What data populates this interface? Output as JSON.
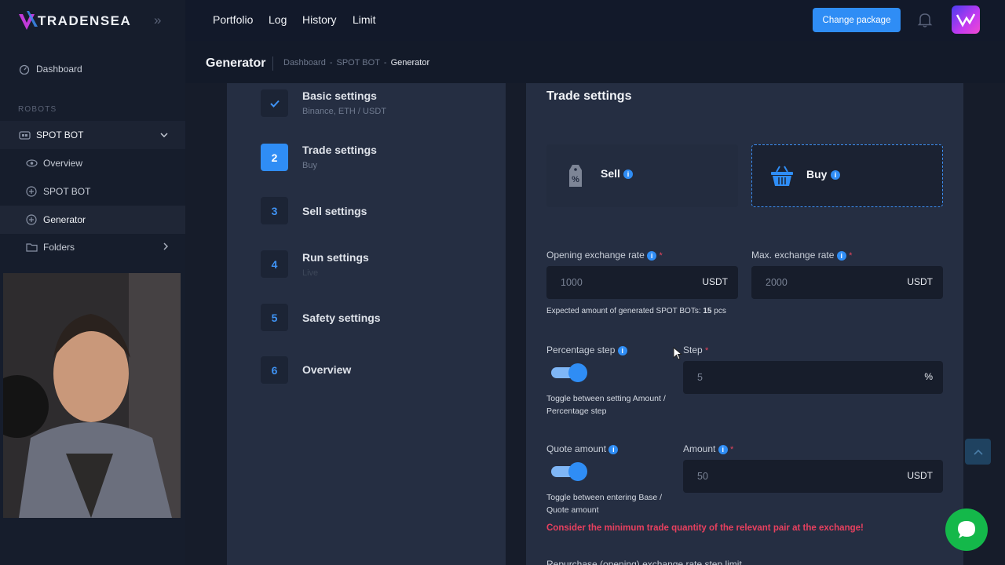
{
  "brand": {
    "name": "TRADENSEA"
  },
  "topnav": {
    "items": [
      "Portfolio",
      "Log",
      "History",
      "Limit"
    ],
    "change_package": "Change package"
  },
  "sidebar": {
    "dashboard": "Dashboard",
    "section": "ROBOTS",
    "group": "SPOT BOT",
    "items": [
      "Overview",
      "SPOT BOT",
      "Generator"
    ],
    "folders": "Folders"
  },
  "header": {
    "title": "Generator",
    "breadcrumb": [
      "Dashboard",
      "SPOT BOT",
      "Generator"
    ]
  },
  "steps": [
    {
      "num": "",
      "title": "Basic settings",
      "sub": "Binance, ETH / USDT"
    },
    {
      "num": "2",
      "title": "Trade settings",
      "sub": "Buy"
    },
    {
      "num": "3",
      "title": "Sell settings",
      "sub": ""
    },
    {
      "num": "4",
      "title": "Run settings",
      "sub": "Live"
    },
    {
      "num": "5",
      "title": "Safety settings",
      "sub": ""
    },
    {
      "num": "6",
      "title": "Overview",
      "sub": ""
    }
  ],
  "trade": {
    "title": "Trade settings",
    "sell_label": "Sell",
    "buy_label": "Buy",
    "opening_rate_label": "Opening exchange rate",
    "opening_rate_value": "1000",
    "max_rate_label": "Max. exchange rate",
    "max_rate_value": "2000",
    "unit_usdt": "USDT",
    "expected_text": "Expected amount of generated SPOT BOTs:",
    "expected_value": "15",
    "expected_unit": "pcs",
    "percentage_step_label": "Percentage step",
    "percentage_step_hint": "Toggle between setting Amount / Percentage step",
    "step_label": "Step",
    "step_value": "5",
    "step_unit": "%",
    "quote_amount_label": "Quote amount",
    "quote_amount_hint": "Toggle between entering Base / Quote amount",
    "amount_label": "Amount",
    "amount_value": "50",
    "warning": "Consider the minimum trade quantity of the relevant pair at the exchange!",
    "next_label": "Repurchase (opening) exchange rate step limit"
  },
  "colors": {
    "accent": "#2f8df5",
    "warning": "#e8405f",
    "chat": "#14b84a"
  }
}
